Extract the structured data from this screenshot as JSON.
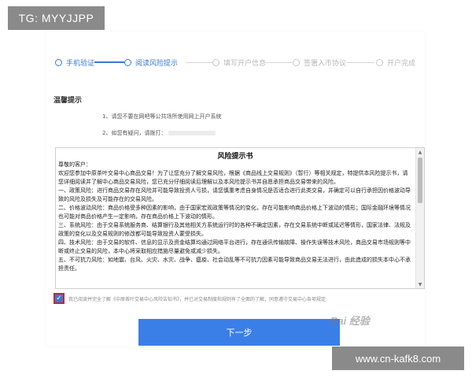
{
  "overlay": {
    "tg_label": "TG: MYYJJPP",
    "url_label": "www.cn-kafk8.com",
    "watermark": "Bai 经验"
  },
  "steps": [
    {
      "label": "手机验证",
      "active": true
    },
    {
      "label": "阅读风险提示",
      "active": true
    },
    {
      "label": "填写开户信息",
      "active": false
    },
    {
      "label": "签署入市协议",
      "active": false
    },
    {
      "label": "开户完成",
      "active": false
    }
  ],
  "tips": {
    "title": "温馨提示",
    "items": [
      "1、请您不要在网吧等公共场所使用网上开户系统",
      "2、如您有疑问，请拨打："
    ]
  },
  "risk": {
    "title": "风险提示书",
    "paragraphs": [
      "尊敬的客户：",
      "    欢迎您参加中原茶叶交易中心商品交易！为了让您充分了解交易风险，根据《商品线上交易规则》（暂行）等相关规定，特提供本风险提示书，请您详细阅读并了解中心商品交易风险，您已充分仔细阅读后理解以及本风险提示书并自愿承担商品交易带来的风险。",
      "    一、政策风险：进行商品交易存在风险并可能导致投资人亏损，请您慎重考虑自身情况是否适合进行此类交易，并确定可以自行承担因价格波动导致的风险及损失及可能存在的交易风险。",
      "    二、价格波动风险：商品价格受多种因素的影响，由于国家宏观政策等情况的变化，存在可能影响商品价格上下波动的情形；国际金融环境等情况也可能对商品价格产生一定影响，存在商品价格上下波动的情形。",
      "    三、系统风险：由于交易系统服务商、结算银行及其他相关方系统运行时的各种不确定因素，存在交易系统中断或延迟等情形，国家法律、法规及政策的变化以及交易规则的修改都可能导致投资人蒙受损失。",
      "    四、技术风险：由于交易的软件、信息的显示及资金结算均通过网络平台进行，存在通讯传输故障、操作失误等技术风险，商品交易市场规则等中断或终止交易的风险，本中心将采取相应措施尽量避免或减少损失。",
      "    五、不可抗力风险：如地震、台风、火灾、水灾、战争、瘟疫、社会动乱等不可抗力因素可能导致商品交易无法进行，由此造成的损失本中心不承担责任。"
    ]
  },
  "agreement": {
    "checked": true,
    "text": "我已阅读并完全了解《中原茶叶交易中心风险告知书》，并已对交易制度和规则有了全面的了解，同意遵守交易中心各项规定"
  },
  "next_button": "下一步"
}
